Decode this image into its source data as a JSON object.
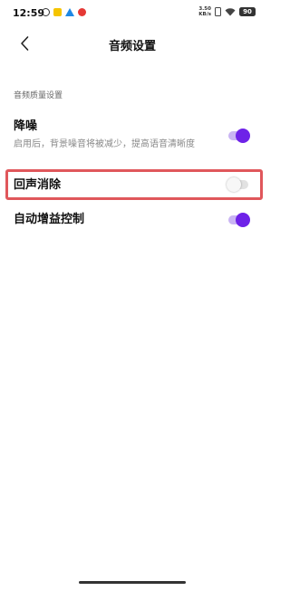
{
  "status_bar": {
    "time": "12:59",
    "net_speed_value": "3.50",
    "net_speed_unit": "KB/s",
    "battery": "90"
  },
  "header": {
    "title": "音频设置",
    "back_icon": "back-arrow-icon"
  },
  "section": {
    "title": "音频质量设置"
  },
  "settings": [
    {
      "title": "降噪",
      "description": "启用后，背景噪音将被减少，提高语音清晰度",
      "enabled": true
    },
    {
      "title": "回声消除",
      "enabled": false,
      "highlighted": true
    },
    {
      "title": "自动增益控制",
      "enabled": true
    }
  ],
  "colors": {
    "toggle_on_knob": "#6e22e8",
    "toggle_on_track": "#c9b4f3",
    "toggle_off_track": "#e2e2e2",
    "highlight_border": "#e0575b"
  }
}
